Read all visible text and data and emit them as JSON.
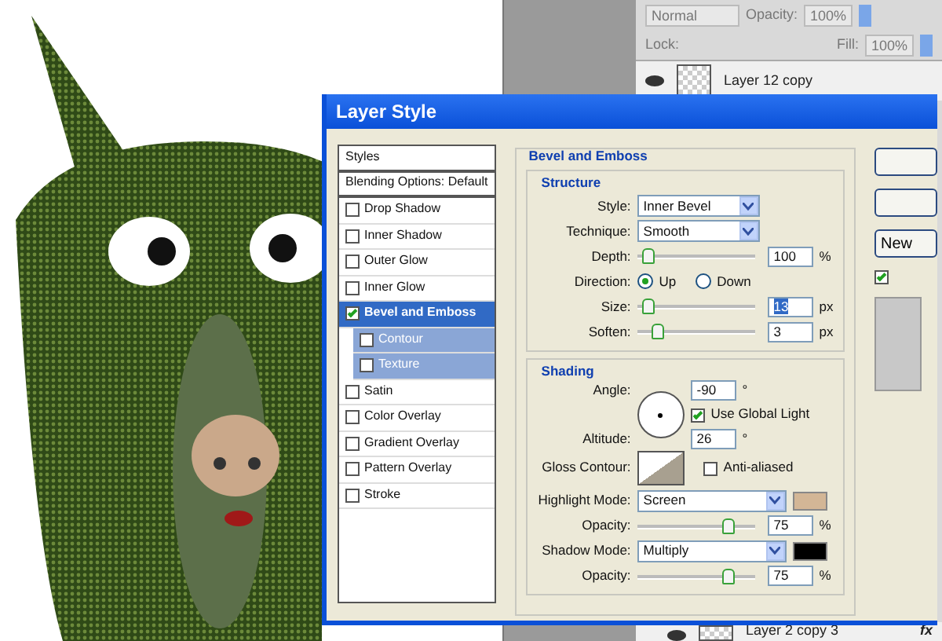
{
  "layers_panel": {
    "blend_mode": "Normal",
    "opacity_label": "Opacity:",
    "opacity": "100%",
    "lock_label": "Lock:",
    "fill_label": "Fill:",
    "fill": "100%",
    "layers": [
      {
        "name": "Layer 12 copy",
        "visible": true
      },
      {
        "name": "Layer 2 copy 3",
        "visible": true,
        "fx": "fx"
      }
    ]
  },
  "dialog": {
    "title": "Layer Style",
    "styles_list": [
      {
        "label": "Styles",
        "kind": "header",
        "selected": false
      },
      {
        "label": "Blending Options: Default",
        "kind": "header",
        "selected": false
      },
      {
        "label": "Drop Shadow",
        "kind": "effect",
        "checked": false,
        "selected": false
      },
      {
        "label": "Inner Shadow",
        "kind": "effect",
        "checked": false,
        "selected": false
      },
      {
        "label": "Outer Glow",
        "kind": "effect",
        "checked": false,
        "selected": false
      },
      {
        "label": "Inner Glow",
        "kind": "effect",
        "checked": false,
        "selected": false
      },
      {
        "label": "Bevel and Emboss",
        "kind": "effect",
        "checked": true,
        "selected": true,
        "children": [
          {
            "label": "Contour",
            "kind": "effect",
            "checked": false,
            "selected": false
          },
          {
            "label": "Texture",
            "kind": "effect",
            "checked": false,
            "selected": false
          }
        ]
      },
      {
        "label": "Satin",
        "kind": "effect",
        "checked": false,
        "selected": false
      },
      {
        "label": "Color Overlay",
        "kind": "effect",
        "checked": false,
        "selected": false
      },
      {
        "label": "Gradient Overlay",
        "kind": "effect",
        "checked": false,
        "selected": false
      },
      {
        "label": "Pattern Overlay",
        "kind": "effect",
        "checked": false,
        "selected": false
      },
      {
        "label": "Stroke",
        "kind": "effect",
        "checked": false,
        "selected": false
      }
    ],
    "section_title": "Bevel and Emboss",
    "groups": [
      {
        "title": "Structure",
        "rows": [
          {
            "kind": "select",
            "label": "Style:",
            "value": "Inner Bevel"
          },
          {
            "kind": "select",
            "label": "Technique:",
            "value": "Smooth"
          },
          {
            "kind": "slider",
            "label": "Depth:",
            "level": 0.1,
            "value": "100",
            "unit": "%",
            "value_selected": false
          },
          {
            "kind": "radio",
            "label": "Direction:",
            "options": [
              {
                "label": "Up",
                "selected": true
              },
              {
                "label": "Down",
                "selected": false
              }
            ]
          },
          {
            "kind": "slider",
            "label": "Size:",
            "level": 0.1,
            "value": "13",
            "unit": "px",
            "value_selected": true
          },
          {
            "kind": "slider",
            "label": "Soften:",
            "level": 0.18,
            "value": "3",
            "unit": "px",
            "value_selected": false
          }
        ]
      },
      {
        "title": "Shading",
        "rows": [
          {
            "kind": "angle",
            "label": "Angle:",
            "value": "-90",
            "unit": "°",
            "global_light": {
              "label": "Use Global Light",
              "checked": true
            },
            "altitude_label": "Altitude:",
            "altitude": "26",
            "altitude_unit": "°"
          },
          {
            "kind": "contour",
            "label": "Gloss Contour:",
            "anti_aliased": {
              "label": "Anti-aliased",
              "checked": false
            }
          },
          {
            "kind": "mode",
            "label": "Highlight Mode:",
            "value": "Screen",
            "color": "#d3b696"
          },
          {
            "kind": "slider",
            "label": "Opacity:",
            "level": 0.78,
            "value": "75",
            "unit": "%",
            "value_selected": false
          },
          {
            "kind": "mode",
            "label": "Shadow Mode:",
            "value": "Multiply",
            "color": "#000000"
          },
          {
            "kind": "slider",
            "label": "Opacity:",
            "level": 0.78,
            "value": "75",
            "unit": "%",
            "value_selected": false
          }
        ]
      }
    ],
    "buttons": [
      {
        "kind": "blank"
      },
      {
        "kind": "blank"
      },
      {
        "kind": "text",
        "label": "New"
      }
    ],
    "preview": {
      "checked": true
    }
  }
}
